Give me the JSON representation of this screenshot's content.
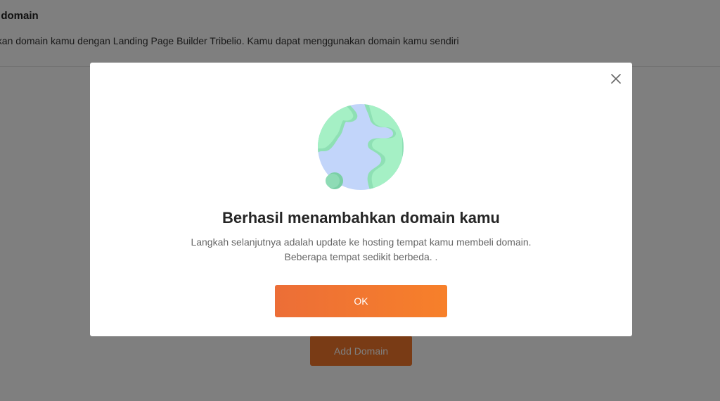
{
  "page": {
    "title": "n domain",
    "description": "gkan domain kamu dengan Landing Page Builder Tribelio. Kamu dapat menggunakan domain kamu sendiri",
    "add_domain_label": "Add Domain"
  },
  "modal": {
    "title": "Berhasil menambahkan domain kamu",
    "body_line1": "Langkah selanjutnya adalah update ke hosting tempat kamu membeli domain.",
    "body_line2": "Beberapa tempat sedikit berbeda. .",
    "ok_label": "OK",
    "close_icon": "close-icon",
    "illustration_icon": "globe-icon"
  },
  "colors": {
    "accent": "#f2762a",
    "globe_ocean": "#c2d5fa",
    "globe_land": "#a5f0c5",
    "globe_moon": "#7bcfa6"
  }
}
